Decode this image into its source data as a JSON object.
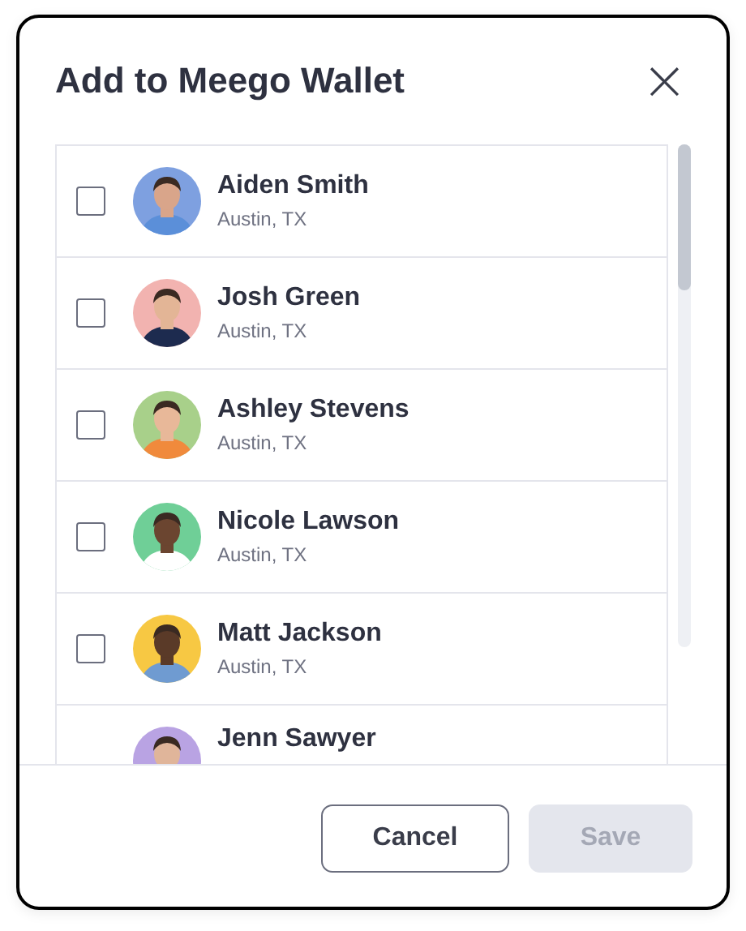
{
  "dialog": {
    "title": "Add to Meego Wallet",
    "close": "×"
  },
  "contacts": [
    {
      "name": "Aiden Smith",
      "location": "Austin, TX",
      "checked": false
    },
    {
      "name": "Josh Green",
      "location": "Austin, TX",
      "checked": false
    },
    {
      "name": "Ashley Stevens",
      "location": "Austin, TX",
      "checked": false
    },
    {
      "name": "Nicole Lawson",
      "location": "Austin, TX",
      "checked": false
    },
    {
      "name": "Matt Jackson",
      "location": "Austin, TX",
      "checked": false
    },
    {
      "name": "Jenn Sawyer"
    }
  ],
  "buttons": [
    {
      "label": "Cancel",
      "kind": "secondary",
      "disabled": false
    },
    {
      "label": "Save",
      "kind": "primary",
      "disabled": true
    }
  ]
}
